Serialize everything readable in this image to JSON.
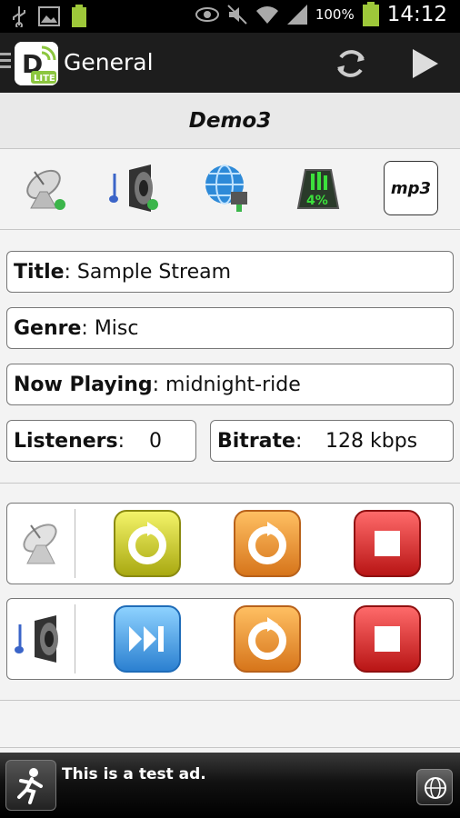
{
  "status_bar": {
    "battery_percent": "100%",
    "time": "14:12",
    "small_battery_label": "100%"
  },
  "app_bar": {
    "title": "General",
    "logo_badge": "LITE",
    "logo_letter": "D"
  },
  "station": {
    "name": "Demo3"
  },
  "tabs": [
    {
      "icon": "satellite-dish-icon"
    },
    {
      "icon": "speaker-note-icon"
    },
    {
      "icon": "globe-network-icon"
    },
    {
      "icon": "usage-meter-icon",
      "label": "4%"
    },
    {
      "icon": "mp3-icon",
      "label": "mp3"
    }
  ],
  "info": {
    "title_label": "Title",
    "title_value": ": Sample Stream",
    "genre_label": "Genre",
    "genre_value": ": Misc",
    "now_playing_label": "Now Playing",
    "now_playing_value": ": midnight-ride",
    "listeners_label": "Listeners",
    "listeners_colon": ":",
    "listeners_value": "0",
    "bitrate_label": "Bitrate",
    "bitrate_colon": ":",
    "bitrate_value": "128 kbps"
  },
  "controls": {
    "source_row": {
      "icon": "satellite-dish-icon",
      "buttons": [
        {
          "icon": "restart-icon",
          "color": "#d8d81e"
        },
        {
          "icon": "restart-icon",
          "color": "#f09a2a"
        },
        {
          "icon": "stop-icon",
          "color": "#e02424"
        }
      ]
    },
    "player_row": {
      "icon": "speaker-note-icon",
      "buttons": [
        {
          "icon": "skip-forward-icon",
          "color": "#3aa4e8"
        },
        {
          "icon": "restart-icon",
          "color": "#f09a2a"
        },
        {
          "icon": "stop-icon",
          "color": "#e02424"
        }
      ]
    }
  },
  "ad": {
    "text": "This is a test ad."
  }
}
